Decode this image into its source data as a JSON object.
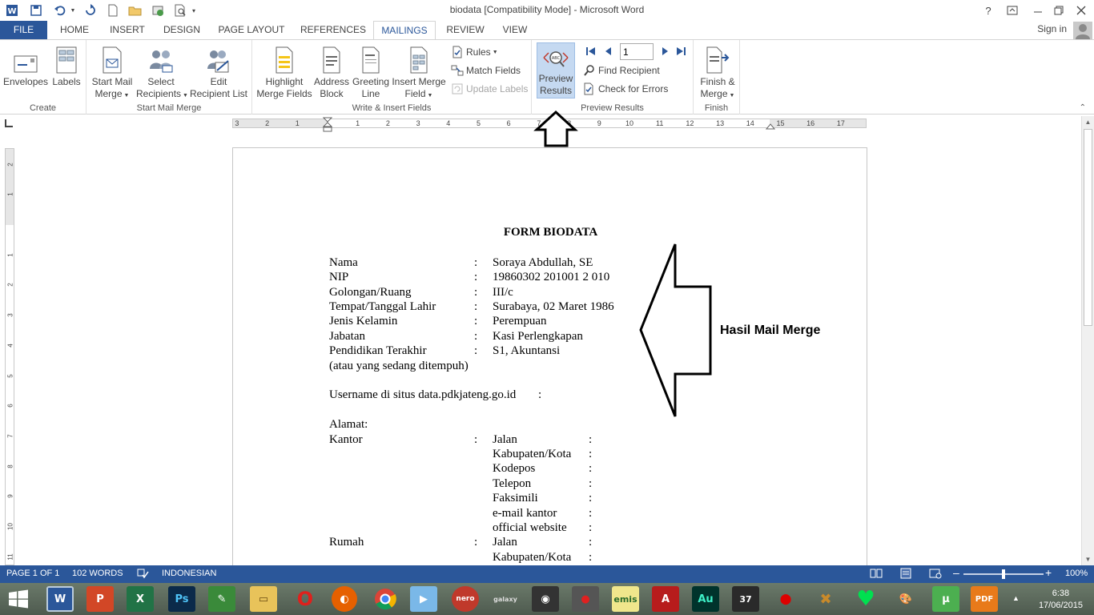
{
  "window": {
    "title": "biodata [Compatibility Mode] - Microsoft Word",
    "help": "?",
    "sign_in": "Sign in"
  },
  "tabs": [
    "FILE",
    "HOME",
    "INSERT",
    "DESIGN",
    "PAGE LAYOUT",
    "REFERENCES",
    "MAILINGS",
    "REVIEW",
    "VIEW"
  ],
  "ribbon": {
    "create": {
      "label": "Create",
      "envelopes": "Envelopes",
      "labels": "Labels"
    },
    "start_mail_merge": {
      "label": "Start Mail Merge",
      "start_1": "Start Mail",
      "start_2": "Merge",
      "select_1": "Select",
      "select_2": "Recipients",
      "edit_1": "Edit",
      "edit_2": "Recipient List"
    },
    "write_insert": {
      "label": "Write & Insert Fields",
      "highlight_1": "Highlight",
      "highlight_2": "Merge Fields",
      "address_1": "Address",
      "address_2": "Block",
      "greeting_1": "Greeting",
      "greeting_2": "Line",
      "insert_1": "Insert Merge",
      "insert_2": "Field",
      "rules": "Rules",
      "match_fields": "Match Fields",
      "update_labels": "Update Labels"
    },
    "preview": {
      "label": "Preview Results",
      "preview_1": "Preview",
      "preview_2": "Results",
      "record": "1",
      "find_recipient": "Find Recipient",
      "check_errors": "Check for Errors"
    },
    "finish": {
      "label": "Finish",
      "finish_1": "Finish &",
      "finish_2": "Merge"
    }
  },
  "ruler": {
    "h_numbers": [
      "3",
      "2",
      "1",
      "1",
      "2",
      "3",
      "4",
      "5",
      "6",
      "7",
      "8",
      "9",
      "10",
      "11",
      "12",
      "13",
      "14",
      "15",
      "16",
      "17"
    ],
    "v_numbers": [
      "2",
      "1",
      "1",
      "2",
      "3",
      "4",
      "5",
      "6",
      "7",
      "8",
      "9",
      "10",
      "11"
    ]
  },
  "document": {
    "title": "FORM BIODATA",
    "fields": [
      {
        "label": "Nama",
        "value": "Soraya Abdullah, SE"
      },
      {
        "label": "NIP",
        "value": "19860302 201001 2 010"
      },
      {
        "label": "Golongan/Ruang",
        "value": "III/c"
      },
      {
        "label": "Tempat/Tanggal Lahir",
        "value": "Surabaya, 02 Maret 1986"
      },
      {
        "label": "Jenis Kelamin",
        "value": "Perempuan"
      },
      {
        "label": "Jabatan",
        "value": "Kasi Perlengkapan"
      },
      {
        "label": "Pendidikan Terakhir",
        "value": "S1, Akuntansi"
      }
    ],
    "pendidikan_note": "(atau yang sedang ditempuh)",
    "username": "Username di situs data.pdkjateng.go.id",
    "alamat": "Alamat:",
    "kantor": {
      "label": "Kantor",
      "items": [
        "Jalan",
        "Kabupaten/Kota",
        "Kodepos",
        "Telepon",
        "Faksimili",
        "e-mail kantor",
        "official website"
      ]
    },
    "rumah": {
      "label": "Rumah",
      "items": [
        "Jalan",
        "Kabupaten/Kota"
      ]
    },
    "colon": ":"
  },
  "annotation": {
    "label": "Hasil Mail Merge"
  },
  "status": {
    "page": "PAGE 1 OF 1",
    "words": "102 WORDS",
    "language": "INDONESIAN",
    "zoom": "100%",
    "zoom_level": 0.5
  },
  "taskbar": {
    "time": "6:38",
    "date": "17/06/2015"
  },
  "colors": {
    "accent": "#2b579a",
    "preview_highlight": "#c5d9f1"
  }
}
